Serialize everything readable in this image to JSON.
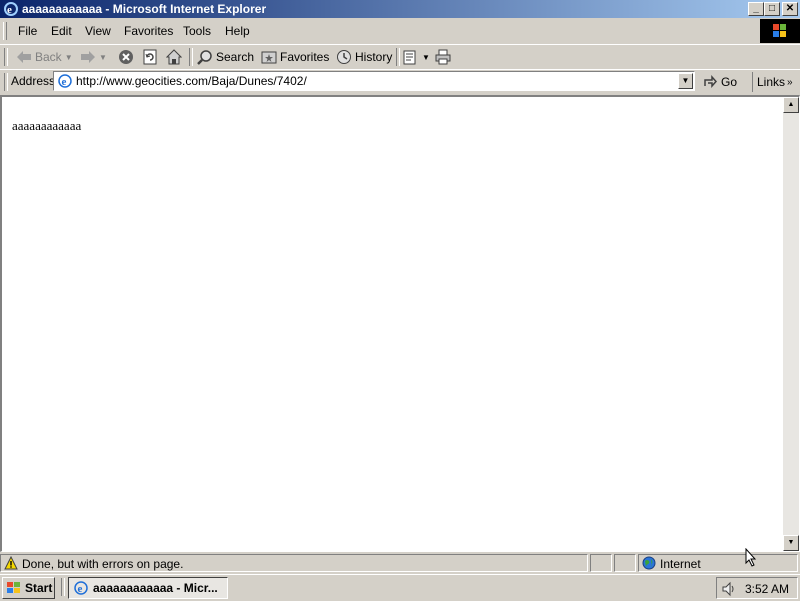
{
  "window": {
    "title": "aaaaaaaaaaaa - Microsoft Internet Explorer"
  },
  "menu": {
    "items": [
      {
        "label": "File"
      },
      {
        "label": "Edit"
      },
      {
        "label": "View"
      },
      {
        "label": "Favorites"
      },
      {
        "label": "Tools"
      },
      {
        "label": "Help"
      }
    ]
  },
  "toolbar": {
    "back_label": "Back",
    "search_label": "Search",
    "favorites_label": "Favorites",
    "history_label": "History"
  },
  "address": {
    "label": "Address",
    "url": "http://www.geocities.com/Baja/Dunes/7402/",
    "go_label": "Go",
    "links_label": "Links"
  },
  "page": {
    "text": "aaaaaaaaaaaa"
  },
  "status": {
    "message": "Done, but with errors on page.",
    "zone": "Internet"
  },
  "taskbar": {
    "start_label": "Start",
    "task_label": "aaaaaaaaaaaa - Micr...",
    "clock": "3:52 AM"
  },
  "icons": {
    "title": "ie-icon",
    "error": "warning-icon",
    "zone": "globe-icon",
    "volume": "speaker-icon"
  },
  "colors": {
    "titlebar_start": "#0a246a",
    "titlebar_end": "#a6caf0",
    "chrome": "#d4d0c8"
  }
}
